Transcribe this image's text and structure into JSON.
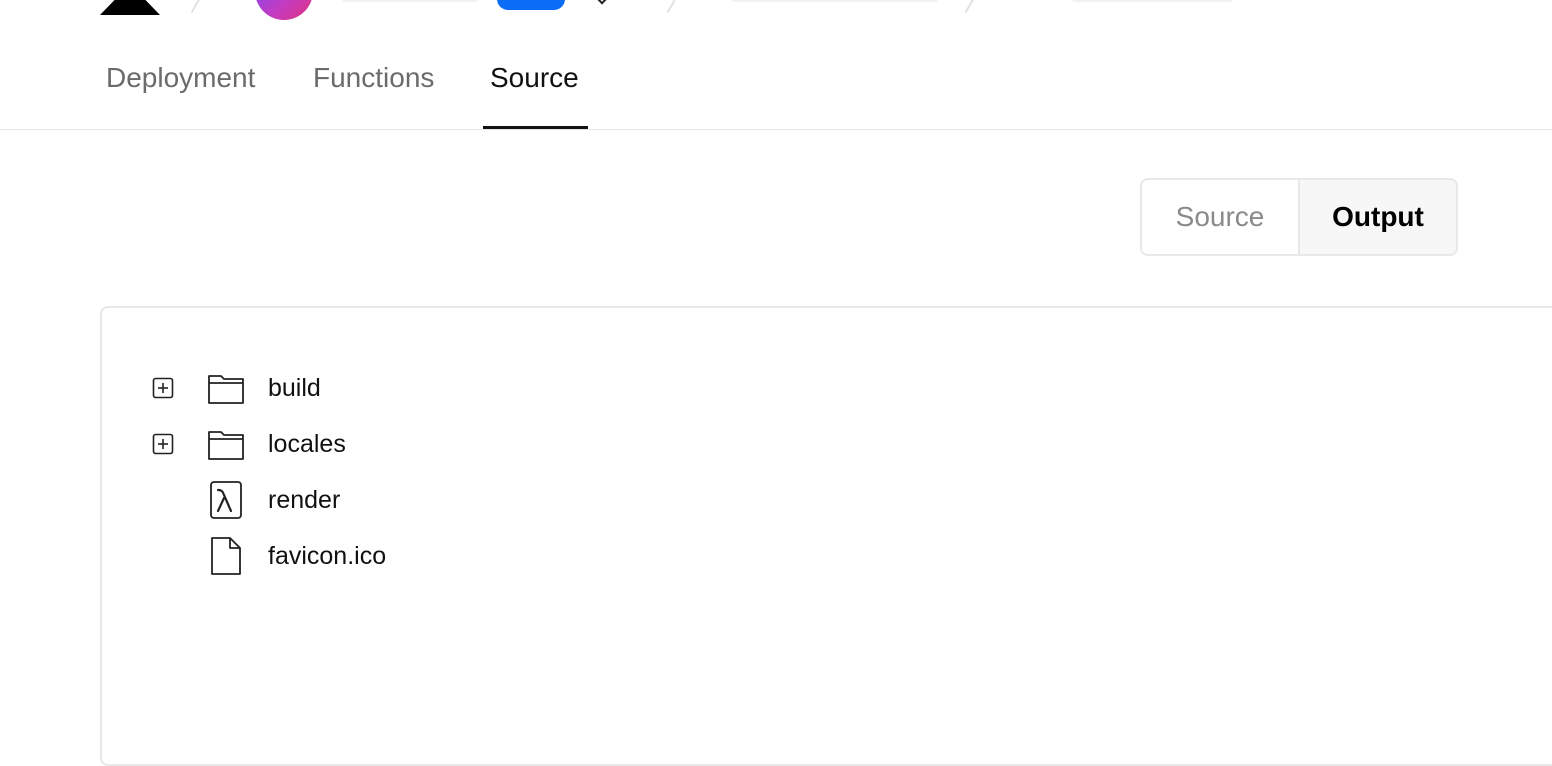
{
  "tabs": [
    {
      "label": "Deployment",
      "active": false
    },
    {
      "label": "Functions",
      "active": false
    },
    {
      "label": "Source",
      "active": true
    }
  ],
  "view_toggle": {
    "options": [
      "Source",
      "Output"
    ],
    "selected": "Output"
  },
  "file_tree": {
    "items": [
      {
        "name": "build",
        "type": "folder",
        "icon": "folder-icon",
        "expandable": true
      },
      {
        "name": "locales",
        "type": "folder",
        "icon": "folder-icon",
        "expandable": true
      },
      {
        "name": "render",
        "type": "function",
        "icon": "lambda-icon",
        "expandable": false
      },
      {
        "name": "favicon.ico",
        "type": "file",
        "icon": "file-icon",
        "expandable": false
      }
    ]
  },
  "colors": {
    "accent_blue": "#0b6cf5",
    "active_text": "#111111",
    "inactive_text": "#6b6b6b",
    "border": "#e8e8e8"
  }
}
